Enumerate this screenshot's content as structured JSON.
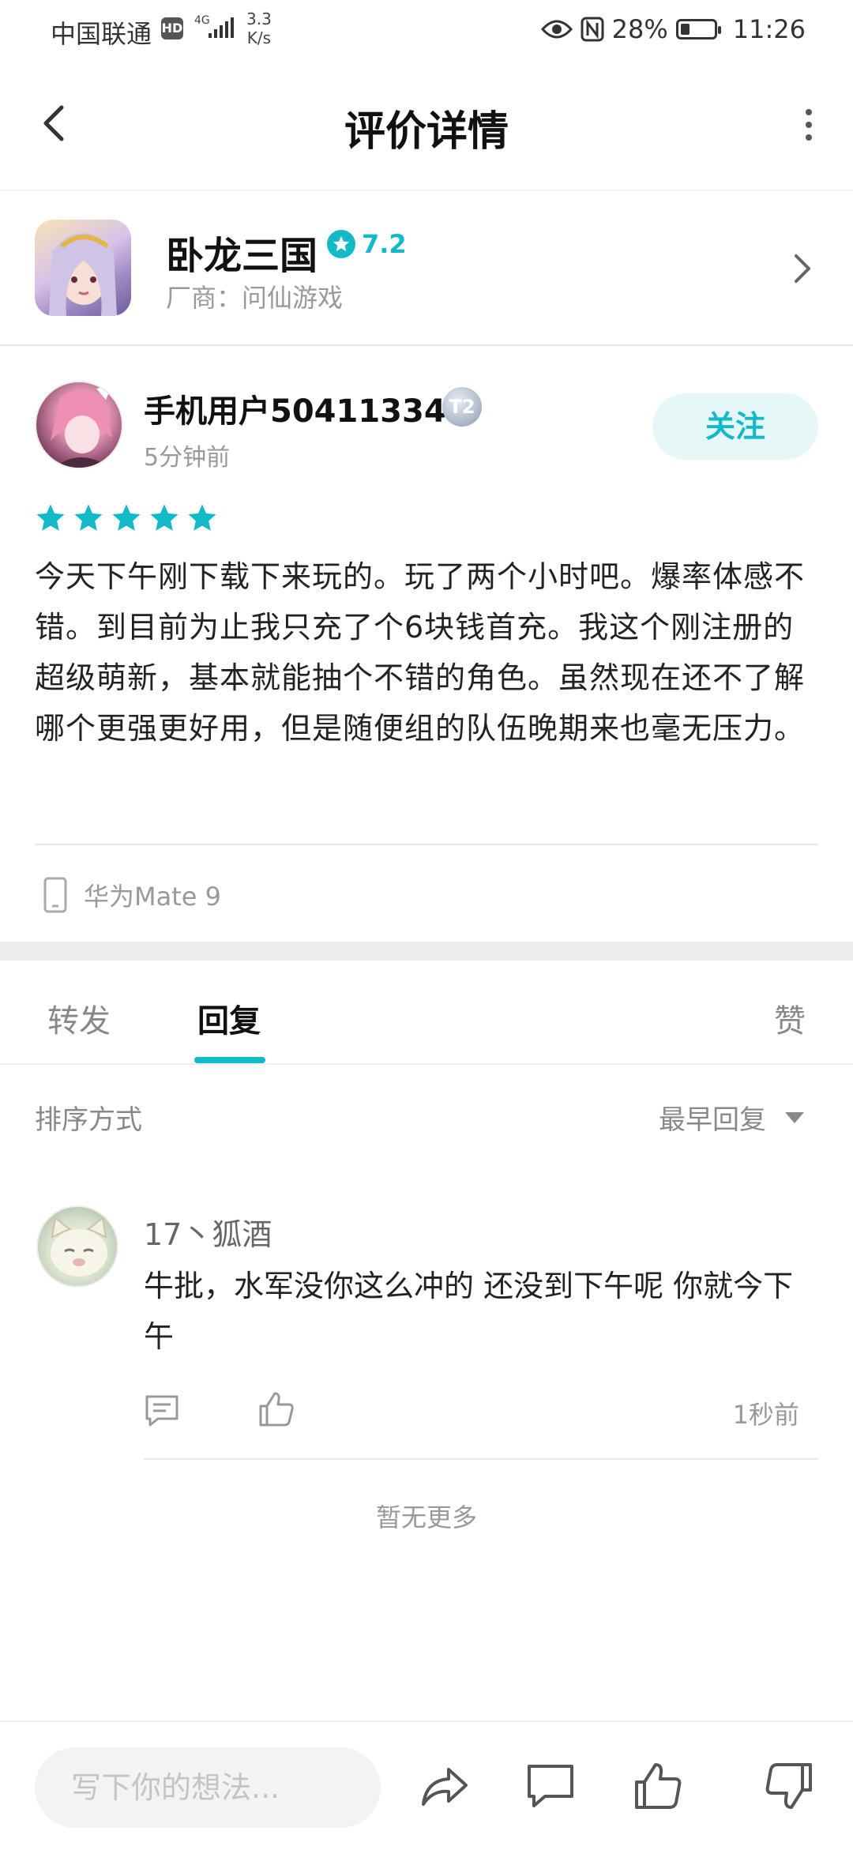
{
  "status_bar": {
    "carrier": "中国联通",
    "hd": "HD",
    "network": "4G",
    "speed_value": "3.3",
    "speed_unit": "K/s",
    "battery_percent": "28%",
    "battery_level": 0.28,
    "time": "11:26"
  },
  "topbar": {
    "title": "评价详情"
  },
  "game": {
    "name": "卧龙三国",
    "rating": "7.2",
    "vendor_label": "厂商：问仙游戏"
  },
  "review": {
    "username": "手机用户50411334",
    "level_badge": "T2",
    "time_ago": "5分钟前",
    "follow_label": "关注",
    "stars": 5,
    "content": "今天下午刚下载下来玩的。玩了两个小时吧。爆率体感不错。到目前为止我只充了个6块钱首充。我这个刚注册的超级萌新，基本就能抽个不错的角色。虽然现在还不了解哪个更强更好用，但是随便组的队伍晚期来也毫无压力。",
    "device": "华为Mate 9"
  },
  "tabs": {
    "forward": "转发",
    "reply": "回复",
    "like": "赞",
    "active": "reply"
  },
  "sort": {
    "label": "排序方式",
    "selected": "最早回复"
  },
  "replies": [
    {
      "name": "17丶狐酒",
      "text": "牛批，水军没你这么冲的 还没到下午呢 你就今下午",
      "time": "1秒前"
    }
  ],
  "no_more": "暂无更多",
  "bottom_bar": {
    "input_placeholder": "写下你的想法..."
  },
  "colors": {
    "accent": "#14b9c8",
    "follow_bg": "#e6f7f8",
    "muted_text": "#999999"
  }
}
